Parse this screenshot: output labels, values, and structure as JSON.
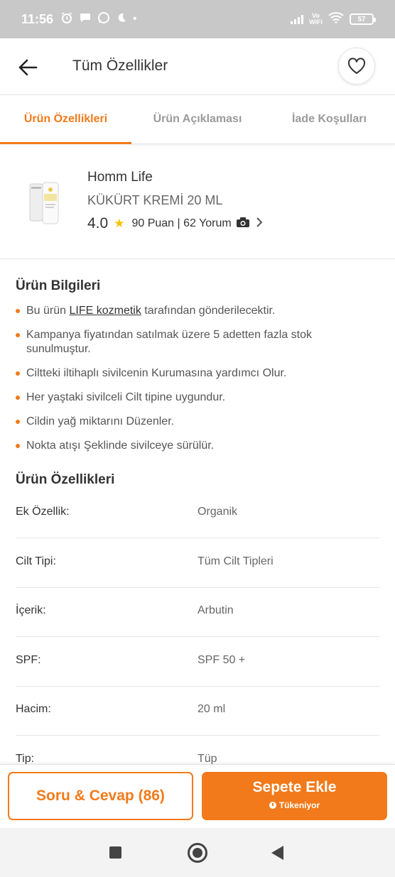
{
  "status_bar": {
    "time": "11:56",
    "volte_top": "Vo",
    "volte_bottom": "WiFi",
    "battery": "57"
  },
  "header": {
    "title": "Tüm Özellikler"
  },
  "tabs": [
    {
      "label": "Ürün Özellikleri",
      "active": true
    },
    {
      "label": "Ürün Açıklaması",
      "active": false
    },
    {
      "label": "İade Koşulları",
      "active": false
    }
  ],
  "product": {
    "brand": "Homm Life",
    "name": "KÜKÜRT KREMİ 20 ML",
    "rating": "4.0",
    "reviews": "90 Puan | 62 Yorum"
  },
  "info": {
    "title": "Ürün Bilgileri",
    "bullets": [
      {
        "pre": "Bu ürün ",
        "link": "LIFE kozmetik",
        "post": " tarafından gönderilecektir."
      },
      {
        "text": "Kampanya fiyatından satılmak üzere 5 adetten fazla stok sunulmuştur."
      },
      {
        "text": "Ciltteki iltihaplı sivilcenin Kurumasına yardımcı Olur."
      },
      {
        "text": "Her yaştaki sivilceli Cilt tipine uygundur."
      },
      {
        "text": "Cildin yağ miktarını Düzenler."
      },
      {
        "text": "Nokta atışı Şeklinde sivilceye sürülür."
      }
    ]
  },
  "features": {
    "title": "Ürün Özellikleri",
    "rows": [
      {
        "label": "Ek Özellik:",
        "value": "Organik"
      },
      {
        "label": "Cilt Tipi:",
        "value": "Tüm Cilt Tipleri"
      },
      {
        "label": "İçerik:",
        "value": "Arbutin"
      },
      {
        "label": "SPF:",
        "value": "SPF 50 +"
      },
      {
        "label": "Hacim:",
        "value": "20 ml"
      },
      {
        "label": "Tip:",
        "value": "Tüp"
      }
    ]
  },
  "bottom": {
    "qa_label": "Soru & Cevap (86)",
    "cart_label": "Sepete Ekle",
    "cart_sub": "Tükeniyor"
  },
  "colors": {
    "accent": "#f27a1a",
    "star": "#f8c300"
  }
}
